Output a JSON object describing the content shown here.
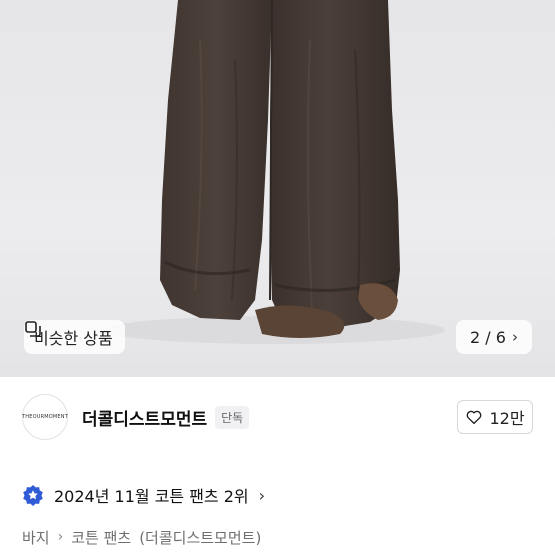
{
  "gallery": {
    "similar_label": "비슷한 상품",
    "page_indicator": "2 / 6"
  },
  "shop": {
    "logo_text": "THEOURMOMENT",
    "name": "더콜디스트모먼트",
    "badge": "단독",
    "like_count": "12만"
  },
  "ranking": {
    "text": "2024년 11월 코튼 팬츠 2위",
    "icon_color": "#2f5bd6"
  },
  "breadcrumb": {
    "items": [
      "바지",
      "코튼 팬츠",
      "(더콜디스트모먼트)"
    ]
  }
}
